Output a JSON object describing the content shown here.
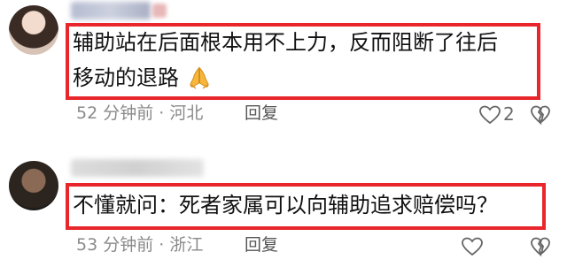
{
  "comments": [
    {
      "text_line1": "辅助站在后面根本用不上力，反而阻断了往后",
      "text_line2": "移动的退路",
      "emoji": "pray-hands-emoji",
      "time_location": "52 分钟前 · 河北",
      "reply_label": "回复",
      "like_count": "2"
    },
    {
      "text_line1": "不懂就问：死者家属可以向辅助追求赔偿吗？",
      "time_location": "53 分钟前 · 浙江",
      "reply_label": "回复"
    }
  ],
  "colors": {
    "highlight_border": "#e8262b",
    "comment_text": "#111111",
    "meta_text": "#8a8a8a"
  }
}
